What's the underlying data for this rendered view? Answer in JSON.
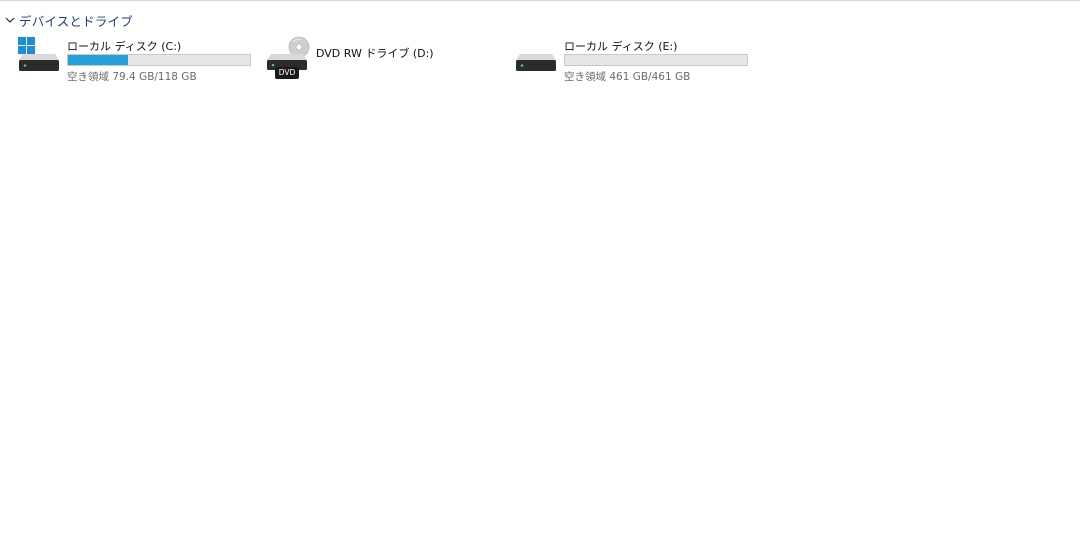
{
  "section": {
    "title": "デバイスとドライブ",
    "chevron_icon": "chevron-down-icon"
  },
  "drives": [
    {
      "name": "ローカル ディスク (C:)",
      "free_text": "空き領域 79.4 GB/118 GB",
      "used_fraction": 0.327,
      "icon": "windows-drive-icon",
      "bar_color": "#26a0da"
    },
    {
      "name": "DVD RW ドライブ (D:)",
      "icon": "dvd-drive-icon",
      "badge": "DVD"
    },
    {
      "name": "ローカル ディスク (E:)",
      "free_text": "空き領域 461 GB/461 GB",
      "used_fraction": 0,
      "icon": "hard-drive-icon",
      "bar_color": "#26a0da"
    }
  ]
}
